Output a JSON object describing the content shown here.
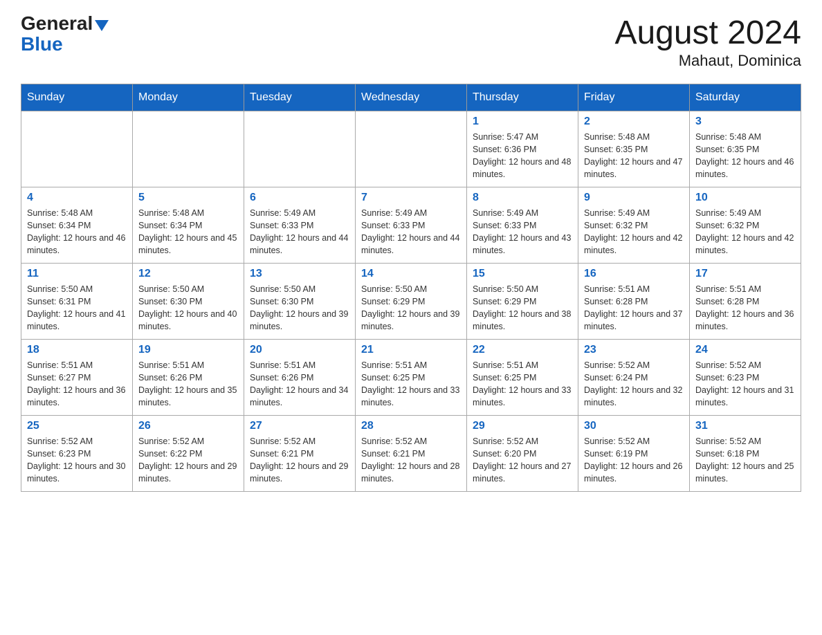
{
  "header": {
    "logo_general": "General",
    "logo_blue": "Blue",
    "main_title": "August 2024",
    "subtitle": "Mahaut, Dominica"
  },
  "calendar": {
    "days_of_week": [
      "Sunday",
      "Monday",
      "Tuesday",
      "Wednesday",
      "Thursday",
      "Friday",
      "Saturday"
    ],
    "weeks": [
      [
        {
          "day": "",
          "info": ""
        },
        {
          "day": "",
          "info": ""
        },
        {
          "day": "",
          "info": ""
        },
        {
          "day": "",
          "info": ""
        },
        {
          "day": "1",
          "info": "Sunrise: 5:47 AM\nSunset: 6:36 PM\nDaylight: 12 hours and 48 minutes."
        },
        {
          "day": "2",
          "info": "Sunrise: 5:48 AM\nSunset: 6:35 PM\nDaylight: 12 hours and 47 minutes."
        },
        {
          "day": "3",
          "info": "Sunrise: 5:48 AM\nSunset: 6:35 PM\nDaylight: 12 hours and 46 minutes."
        }
      ],
      [
        {
          "day": "4",
          "info": "Sunrise: 5:48 AM\nSunset: 6:34 PM\nDaylight: 12 hours and 46 minutes."
        },
        {
          "day": "5",
          "info": "Sunrise: 5:48 AM\nSunset: 6:34 PM\nDaylight: 12 hours and 45 minutes."
        },
        {
          "day": "6",
          "info": "Sunrise: 5:49 AM\nSunset: 6:33 PM\nDaylight: 12 hours and 44 minutes."
        },
        {
          "day": "7",
          "info": "Sunrise: 5:49 AM\nSunset: 6:33 PM\nDaylight: 12 hours and 44 minutes."
        },
        {
          "day": "8",
          "info": "Sunrise: 5:49 AM\nSunset: 6:33 PM\nDaylight: 12 hours and 43 minutes."
        },
        {
          "day": "9",
          "info": "Sunrise: 5:49 AM\nSunset: 6:32 PM\nDaylight: 12 hours and 42 minutes."
        },
        {
          "day": "10",
          "info": "Sunrise: 5:49 AM\nSunset: 6:32 PM\nDaylight: 12 hours and 42 minutes."
        }
      ],
      [
        {
          "day": "11",
          "info": "Sunrise: 5:50 AM\nSunset: 6:31 PM\nDaylight: 12 hours and 41 minutes."
        },
        {
          "day": "12",
          "info": "Sunrise: 5:50 AM\nSunset: 6:30 PM\nDaylight: 12 hours and 40 minutes."
        },
        {
          "day": "13",
          "info": "Sunrise: 5:50 AM\nSunset: 6:30 PM\nDaylight: 12 hours and 39 minutes."
        },
        {
          "day": "14",
          "info": "Sunrise: 5:50 AM\nSunset: 6:29 PM\nDaylight: 12 hours and 39 minutes."
        },
        {
          "day": "15",
          "info": "Sunrise: 5:50 AM\nSunset: 6:29 PM\nDaylight: 12 hours and 38 minutes."
        },
        {
          "day": "16",
          "info": "Sunrise: 5:51 AM\nSunset: 6:28 PM\nDaylight: 12 hours and 37 minutes."
        },
        {
          "day": "17",
          "info": "Sunrise: 5:51 AM\nSunset: 6:28 PM\nDaylight: 12 hours and 36 minutes."
        }
      ],
      [
        {
          "day": "18",
          "info": "Sunrise: 5:51 AM\nSunset: 6:27 PM\nDaylight: 12 hours and 36 minutes."
        },
        {
          "day": "19",
          "info": "Sunrise: 5:51 AM\nSunset: 6:26 PM\nDaylight: 12 hours and 35 minutes."
        },
        {
          "day": "20",
          "info": "Sunrise: 5:51 AM\nSunset: 6:26 PM\nDaylight: 12 hours and 34 minutes."
        },
        {
          "day": "21",
          "info": "Sunrise: 5:51 AM\nSunset: 6:25 PM\nDaylight: 12 hours and 33 minutes."
        },
        {
          "day": "22",
          "info": "Sunrise: 5:51 AM\nSunset: 6:25 PM\nDaylight: 12 hours and 33 minutes."
        },
        {
          "day": "23",
          "info": "Sunrise: 5:52 AM\nSunset: 6:24 PM\nDaylight: 12 hours and 32 minutes."
        },
        {
          "day": "24",
          "info": "Sunrise: 5:52 AM\nSunset: 6:23 PM\nDaylight: 12 hours and 31 minutes."
        }
      ],
      [
        {
          "day": "25",
          "info": "Sunrise: 5:52 AM\nSunset: 6:23 PM\nDaylight: 12 hours and 30 minutes."
        },
        {
          "day": "26",
          "info": "Sunrise: 5:52 AM\nSunset: 6:22 PM\nDaylight: 12 hours and 29 minutes."
        },
        {
          "day": "27",
          "info": "Sunrise: 5:52 AM\nSunset: 6:21 PM\nDaylight: 12 hours and 29 minutes."
        },
        {
          "day": "28",
          "info": "Sunrise: 5:52 AM\nSunset: 6:21 PM\nDaylight: 12 hours and 28 minutes."
        },
        {
          "day": "29",
          "info": "Sunrise: 5:52 AM\nSunset: 6:20 PM\nDaylight: 12 hours and 27 minutes."
        },
        {
          "day": "30",
          "info": "Sunrise: 5:52 AM\nSunset: 6:19 PM\nDaylight: 12 hours and 26 minutes."
        },
        {
          "day": "31",
          "info": "Sunrise: 5:52 AM\nSunset: 6:18 PM\nDaylight: 12 hours and 25 minutes."
        }
      ]
    ]
  }
}
